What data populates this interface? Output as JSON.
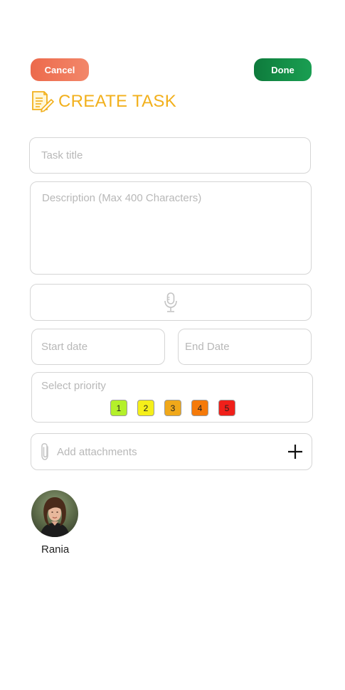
{
  "header": {
    "cancel_label": "Cancel",
    "done_label": "Done",
    "title": "CREATE TASK",
    "title_icon": "notepad-pencil-icon"
  },
  "form": {
    "task_title": {
      "placeholder": "Task title",
      "value": ""
    },
    "description": {
      "placeholder": "Description (Max 400 Characters)",
      "value": ""
    },
    "voice_input": {
      "icon": "microphone-icon"
    },
    "start_date": {
      "placeholder": "Start date",
      "value": ""
    },
    "end_date": {
      "placeholder": "End Date",
      "value": ""
    },
    "priority": {
      "label": "Select priority",
      "options": [
        {
          "label": "1",
          "color": "#b4f02a"
        },
        {
          "label": "2",
          "color": "#f5ef1a"
        },
        {
          "label": "3",
          "color": "#f0a81a"
        },
        {
          "label": "4",
          "color": "#f57a0a"
        },
        {
          "label": "5",
          "color": "#f0201a"
        }
      ]
    },
    "attachments": {
      "label": "Add attachments",
      "icon": "paperclip-icon",
      "add_icon": "plus-icon"
    }
  },
  "assignee": {
    "name": "Rania",
    "avatar_icon": "avatar-photo"
  },
  "colors": {
    "cancel": "#ef7556",
    "done": "#128a44",
    "title": "#f2b01c",
    "border": "#d5d5d5",
    "placeholder": "#b8b8b8"
  }
}
